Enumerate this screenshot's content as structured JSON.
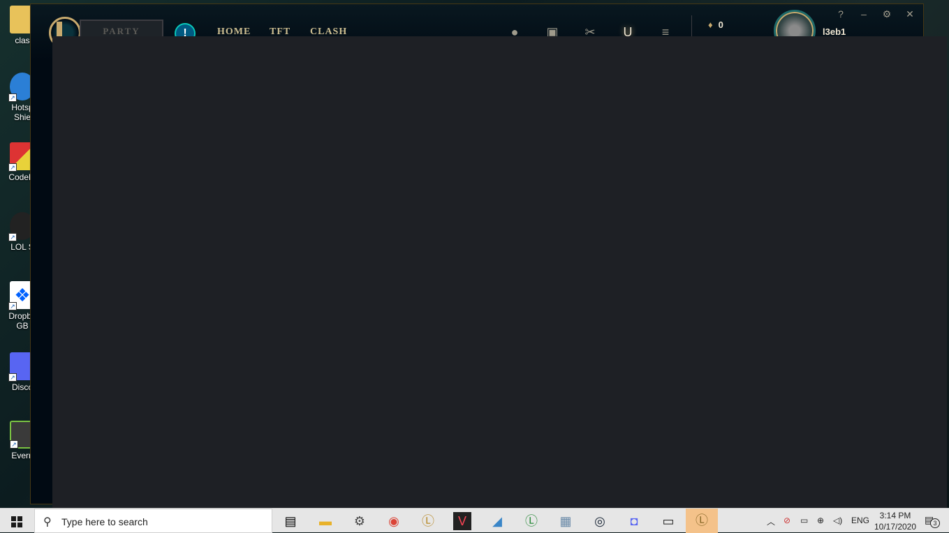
{
  "desktop": {
    "icons": [
      {
        "label": "clas",
        "color": "#e8c25a"
      },
      {
        "label": "Hotsp\nShie",
        "color": "#2b7fd6"
      },
      {
        "label": "CodeBl",
        "color": "#d33"
      },
      {
        "label": "LOL S",
        "color": "#222"
      },
      {
        "label": "Dropbo\nGB",
        "color": "#0061fe"
      },
      {
        "label": "Disco",
        "color": "#5865f2"
      },
      {
        "label": "Evern",
        "color": "#3a3a3a"
      }
    ]
  },
  "client": {
    "party_label": "PARTY",
    "alert_glyph": "!",
    "nav": {
      "home": "HOME",
      "tft": "TFT",
      "clash": "CLASH"
    },
    "currency_value": "0",
    "summoner_name": "l3eb1",
    "window_controls": {
      "help": "?",
      "minimize": "–",
      "settings": "⚙",
      "close": "✕"
    }
  },
  "taskbar": {
    "search_placeholder": "Type here to search",
    "tray_lang": "ENG",
    "time": "3:14 PM",
    "date": "10/17/2020",
    "notification_count": "3"
  }
}
